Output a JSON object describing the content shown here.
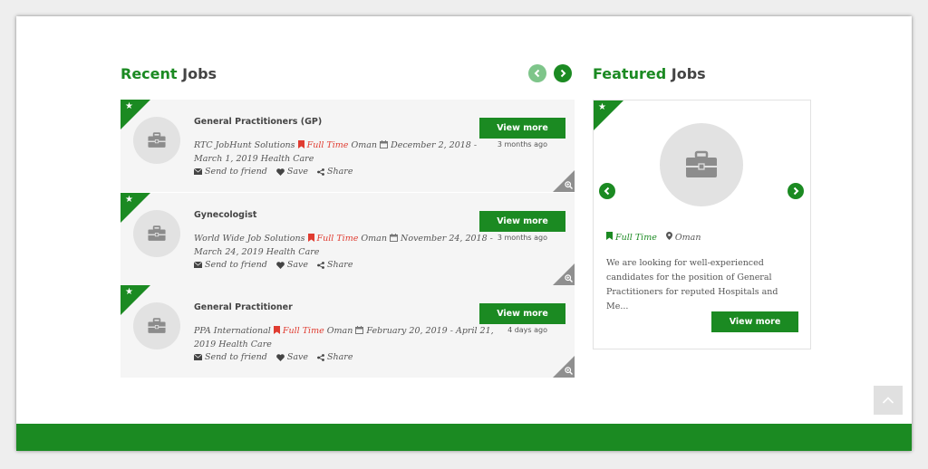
{
  "colors": {
    "brand_green": "#1b8a22",
    "light_green": "#7ec58a",
    "full_time_red": "#e03c31",
    "card_bg": "#f5f5f5"
  },
  "recent": {
    "title_accent": "Recent",
    "title_rest": " Jobs",
    "prev_icon": "chevron-left-icon",
    "next_icon": "chevron-right-icon"
  },
  "jobs": [
    {
      "title": "General Practitioners (GP)",
      "company": "RTC JobHunt Solutions",
      "type": "Full Time",
      "location": "Oman",
      "dates": "December 2, 2018 - March 1, 2019",
      "category": "Health Care",
      "posted": "3 months ago",
      "view_label": "View more",
      "send_label": "Send to friend",
      "save_label": "Save",
      "share_label": "Share"
    },
    {
      "title": "Gynecologist",
      "company": "World Wide Job Solutions",
      "type": "Full Time",
      "location": "Oman",
      "dates": "November 24, 2018 - March 24, 2019",
      "category": "Health Care",
      "posted": "3 months ago",
      "view_label": "View more",
      "send_label": "Send to friend",
      "save_label": "Save",
      "share_label": "Share"
    },
    {
      "title": "General Practitioner",
      "company": "PPA International",
      "type": "Full Time",
      "location": "Oman",
      "dates": "February 20, 2019 - April 21, 2019",
      "category": "Health Care",
      "posted": "4 days ago",
      "view_label": "View more",
      "send_label": "Send to friend",
      "save_label": "Save",
      "share_label": "Share"
    }
  ],
  "featured": {
    "title_accent": "Featured",
    "title_rest": " Jobs",
    "type": "Full Time",
    "location": "Oman",
    "description": "We are looking for well-experienced candidates for the position of General Practitioners for reputed Hospitals and Me...",
    "view_label": "View more"
  }
}
